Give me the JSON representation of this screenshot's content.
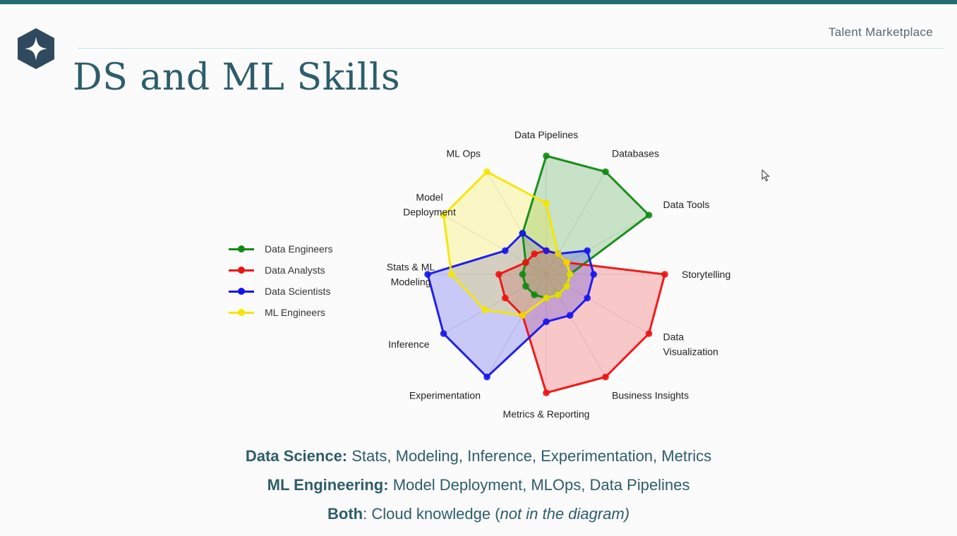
{
  "header": {
    "brand": "Talent Marketplace",
    "title": "DS and ML Skills"
  },
  "chart_data": {
    "type": "radar",
    "axes": [
      "Data Pipelines",
      "Databases",
      "Data Tools",
      "Storytelling",
      "Data Visualization",
      "Business Insights",
      "Metrics & Reporting",
      "Experimentation",
      "Inference",
      "Stats & ML Modeling",
      "Model Deployment",
      "ML Ops"
    ],
    "axis_labels_display": [
      [
        "Data Pipelines"
      ],
      [
        "Databases"
      ],
      [
        "Data Tools"
      ],
      [
        "Storytelling"
      ],
      [
        "Data",
        "Visualization"
      ],
      [
        "Business Insights"
      ],
      [
        "Metrics & Reporting"
      ],
      [
        "Experimentation"
      ],
      [
        "Inference"
      ],
      [
        "Stats & ML",
        "Modeling"
      ],
      [
        "Model",
        "Deployment"
      ],
      [
        "ML Ops"
      ]
    ],
    "range": [
      0,
      5
    ],
    "series": [
      {
        "name": "Data Engineers",
        "color": "#118a11",
        "values": [
          5,
          5,
          5,
          1,
          1,
          1,
          1,
          1,
          1,
          1,
          1,
          2
        ]
      },
      {
        "name": "Data Analysts",
        "color": "#ee1111",
        "values": [
          1,
          1,
          1,
          5,
          5,
          5,
          5,
          2,
          2,
          2,
          1,
          1
        ]
      },
      {
        "name": "Data Scientists",
        "color": "#1515ee",
        "values": [
          1,
          1,
          2,
          2,
          2,
          2,
          2,
          5,
          5,
          5,
          2,
          2
        ]
      },
      {
        "name": "ML Engineers",
        "color": "#f5e600",
        "values": [
          3,
          1,
          1,
          1,
          1,
          1,
          1,
          2,
          3,
          4,
          5,
          5
        ]
      }
    ]
  },
  "notes": [
    {
      "bold": "Data Science:",
      "text": " Stats, Modeling, Inference, Experimentation, Metrics"
    },
    {
      "bold": "ML Engineering:",
      "text": " Model Deployment, MLOps, Data Pipelines"
    },
    {
      "bold": "Both",
      "text": ": Cloud knowledge (",
      "italic": "not in the diagram)"
    }
  ]
}
